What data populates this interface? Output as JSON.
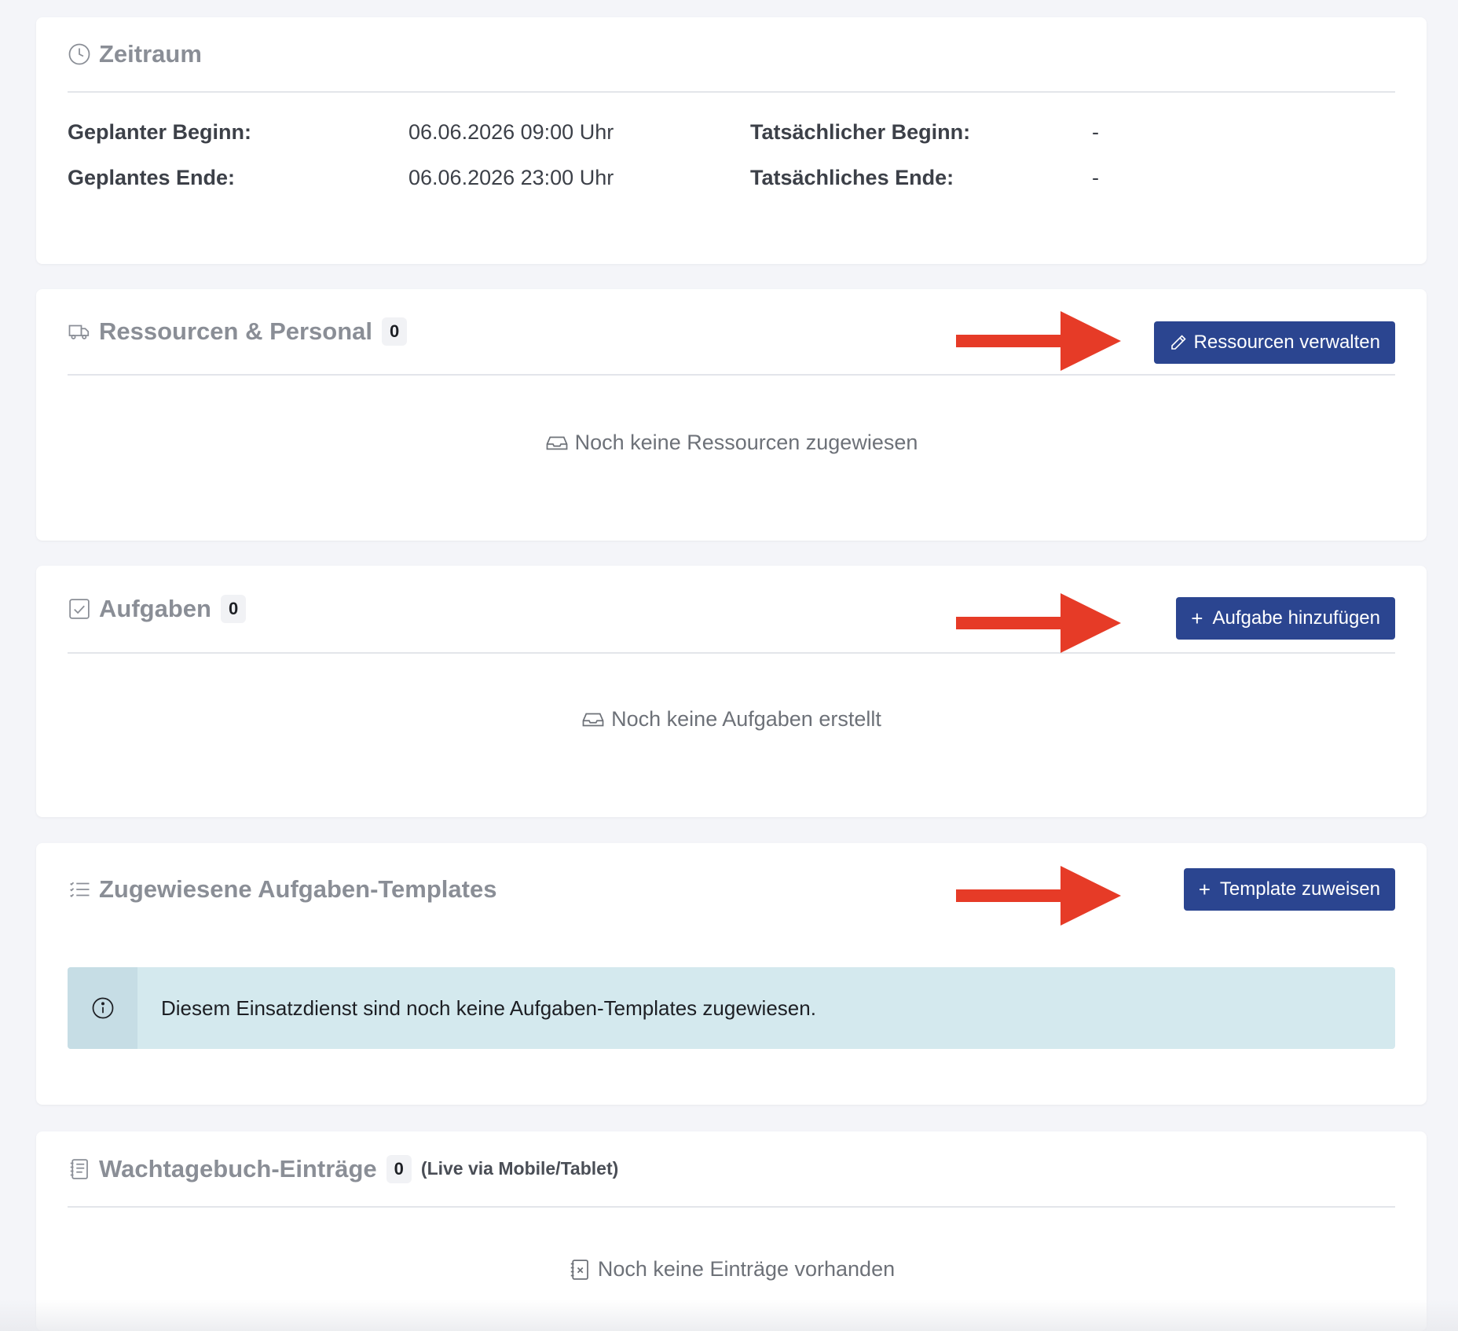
{
  "zeitraum": {
    "title": "Zeitraum",
    "planned_start_label": "Geplanter Beginn:",
    "planned_start_value": "06.06.2026 09:00 Uhr",
    "planned_end_label": "Geplantes Ende:",
    "planned_end_value": "06.06.2026 23:00 Uhr",
    "actual_start_label": "Tatsächlicher Beginn:",
    "actual_start_value": "-",
    "actual_end_label": "Tatsächliches Ende:",
    "actual_end_value": "-"
  },
  "ressourcen": {
    "title": "Ressourcen & Personal",
    "count": "0",
    "button_label": "Ressourcen verwalten",
    "empty_text": "Noch keine Ressourcen zugewiesen"
  },
  "aufgaben": {
    "title": "Aufgaben",
    "count": "0",
    "button_label": "Aufgabe hinzufügen",
    "empty_text": "Noch keine Aufgaben erstellt"
  },
  "templates": {
    "title": "Zugewiesene Aufgaben-Templates",
    "button_label": "Template zuweisen",
    "info_text": "Diesem Einsatzdienst sind noch keine Aufgaben-Templates zugewiesen."
  },
  "wachtagebuch": {
    "title": "Wachtagebuch-Einträge",
    "count": "0",
    "sublabel": "(Live via Mobile/Tablet)",
    "empty_text": "Noch keine Einträge vorhanden"
  },
  "colors": {
    "primary_button": "#2b4590",
    "annotation_arrow": "#e63b27",
    "info_background": "#d4e9ee",
    "page_background": "#f4f5f9"
  },
  "icons": {
    "zeitraum": "clock-icon",
    "ressourcen": "truck-icon",
    "ressourcen_button": "pencil-icon",
    "aufgaben": "checkbox-icon",
    "templates": "list-icon",
    "wachtagebuch": "journal-icon",
    "empty": "inbox-icon",
    "info": "info-icon"
  }
}
